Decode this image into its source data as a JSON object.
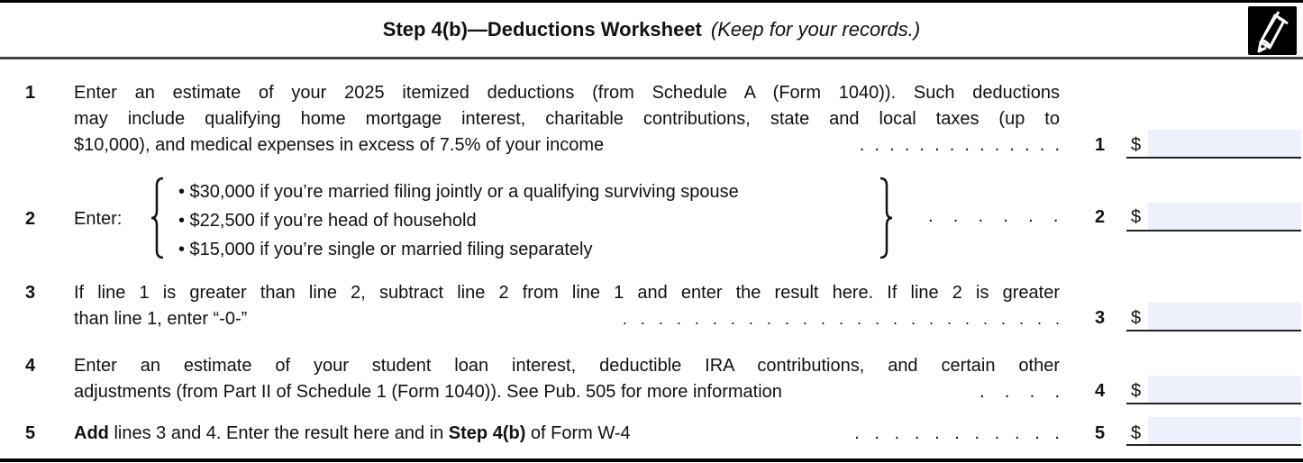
{
  "header": {
    "title_bold": "Step 4(b)—Deductions Worksheet",
    "title_italic": "(Keep for your records.)",
    "icon": "pencil-icon"
  },
  "lines": [
    {
      "num": "1",
      "text_lines": [
        "Enter an estimate of your 2025 itemized deductions (from Schedule A (Form 1040)). Such deductions",
        "may include qualifying home mortgage interest, charitable contributions, state and local taxes (up to",
        "$10,000), and medical expenses in excess of 7.5% of your income"
      ],
      "dots": " .  .  .  .  .  .  .  .  .  .  .  .  .  .",
      "ref": "1",
      "currency": "$",
      "value": ""
    },
    {
      "num": "2",
      "label": "Enter:",
      "options": [
        "• $30,000 if you’re married filing jointly or a qualifying surviving spouse",
        "• $22,500 if you’re head of household",
        "• $15,000 if you’re single or married filing separately"
      ],
      "dots": ".    .    .    .    .    .",
      "ref": "2",
      "currency": "$",
      "value": ""
    },
    {
      "num": "3",
      "text_lines": [
        "If line 1 is greater than line 2, subtract line 2 from line 1 and enter the result here. If line 2 is greater",
        "than line 1, enter “-0-”"
      ],
      "dots": ".   .   .   .   .   .   .   .   .   .   .   .   .   .   .   .   .   .   .   .   .   .   .   .   .",
      "ref": "3",
      "currency": "$",
      "value": ""
    },
    {
      "num": "4",
      "text_lines": [
        "Enter an estimate of your student loan interest, deductible IRA contributions, and certain other",
        "adjustments (from Part II of Schedule 1 (Form 1040)). See Pub. 505 for more information"
      ],
      "dots": ".    .    .    .",
      "ref": "4",
      "currency": "$",
      "value": ""
    },
    {
      "num": "5",
      "bold_a": "Add",
      "text_a": " lines 3 and 4. Enter the result here and in ",
      "bold_b": "Step 4(b)",
      "text_b": " of Form W-4",
      "dots": " .   .   .   .   .   .   .   .   .   .   .",
      "ref": "5",
      "currency": "$",
      "value": ""
    }
  ]
}
